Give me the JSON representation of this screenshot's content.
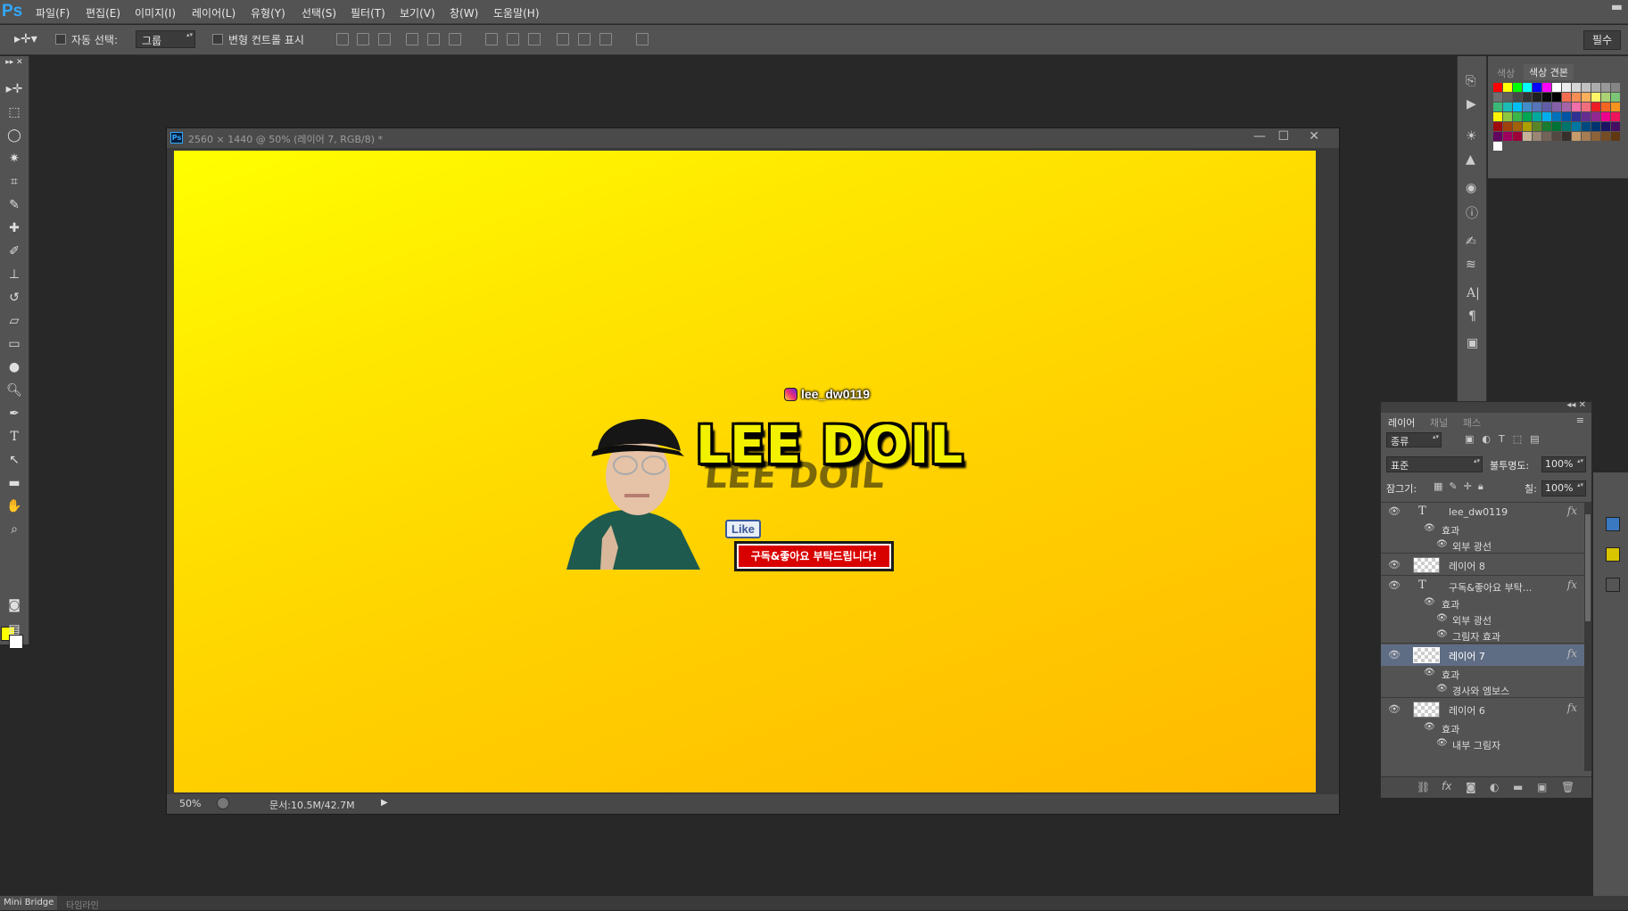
{
  "app": {
    "logo": "Ps"
  },
  "menu": [
    "파일(F)",
    "편집(E)",
    "이미지(I)",
    "레이어(L)",
    "유형(Y)",
    "선택(S)",
    "필터(T)",
    "보기(V)",
    "창(W)",
    "도움말(H)"
  ],
  "options": {
    "auto_select_label": "자동 선택:",
    "auto_select_value": "그룹",
    "transform_controls_label": "변형 컨트롤 표시",
    "essentials_label": "필수"
  },
  "document": {
    "title": "2560 × 1440 @ 50% (레이어 7, RGB/8) *",
    "zoom": "50%",
    "size": "문서:10.5M/42.7M",
    "minimize_icon": "—",
    "restore_icon": "☐",
    "close_icon": "✕"
  },
  "canvas": {
    "instagram": "lee_dw0119",
    "headline": "LEE DOIL",
    "like": "Like",
    "banner": "구독&좋아요 부탁드립니다!"
  },
  "swatches": {
    "tab_color": "색상",
    "tab_swatches": "색상 견본"
  },
  "layers": {
    "tabs": [
      "레이어",
      "채널",
      "패스"
    ],
    "filter": "종류",
    "blend_mode": "표준",
    "opacity_label": "불투명도:",
    "opacity": "100%",
    "lock_label": "잠그기:",
    "fill_label": "칠:",
    "fill": "100%",
    "rows": [
      {
        "name": "lee_dw0119",
        "type": "text",
        "fx": true
      },
      {
        "name": "효과",
        "type": "effects"
      },
      {
        "name": "외부 광선",
        "type": "effect"
      },
      {
        "name": "레이어 8",
        "type": "raster"
      },
      {
        "name": "구독&좋아요 부탁...",
        "type": "text",
        "fx": true
      },
      {
        "name": "효과",
        "type": "effects"
      },
      {
        "name": "외부 광선",
        "type": "effect"
      },
      {
        "name": "그림자 효과",
        "type": "effect"
      },
      {
        "name": "레이어 7",
        "type": "raster",
        "fx": true,
        "selected": true
      },
      {
        "name": "효과",
        "type": "effects"
      },
      {
        "name": "경사와 엠보스",
        "type": "effect"
      },
      {
        "name": "레이어 6",
        "type": "raster",
        "fx": true
      },
      {
        "name": "효과",
        "type": "effects"
      },
      {
        "name": "내부 그림자",
        "type": "effect"
      }
    ]
  },
  "bottom": {
    "mini_bridge": "Mini Bridge",
    "timeline": "타임라인"
  },
  "colors": {
    "foreground": "#ffff00",
    "background": "#ffffff",
    "accent": "#31a8ff"
  }
}
